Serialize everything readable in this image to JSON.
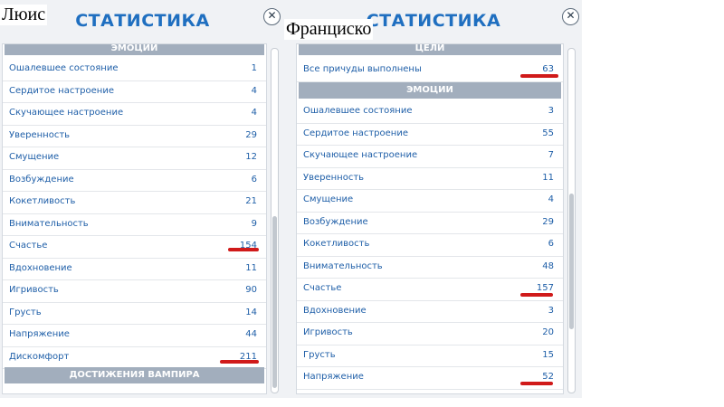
{
  "left": {
    "name_label": "Люис",
    "title": "СТАТИСТИКА",
    "close": "✕",
    "section_top": "ЭМОЦИИ",
    "rows": [
      {
        "label": "Ошалевшее состояние",
        "value": "1"
      },
      {
        "label": "Сердитое настроение",
        "value": "4"
      },
      {
        "label": "Скучающее настроение",
        "value": "4"
      },
      {
        "label": "Уверенность",
        "value": "29"
      },
      {
        "label": "Смущение",
        "value": "12"
      },
      {
        "label": "Возбуждение",
        "value": "6"
      },
      {
        "label": "Кокетливость",
        "value": "21"
      },
      {
        "label": "Внимательность",
        "value": "9"
      },
      {
        "label": "Счастье",
        "value": "154"
      },
      {
        "label": "Вдохновение",
        "value": "11"
      },
      {
        "label": "Игривость",
        "value": "90"
      },
      {
        "label": "Грусть",
        "value": "14"
      },
      {
        "label": "Напряжение",
        "value": "44"
      },
      {
        "label": "Дискомфорт",
        "value": "211"
      }
    ],
    "section_bottom": "ДОСТИЖЕНИЯ ВАМПИРА"
  },
  "right": {
    "name_label": "Франциско",
    "title": "СТАТИСТИКА",
    "close": "✕",
    "section_goals": "ЦЕЛИ",
    "goal_row": {
      "label": "Все причуды выполнены",
      "value": "63"
    },
    "section_emotions": "ЭМОЦИИ",
    "rows": [
      {
        "label": "Ошалевшее состояние",
        "value": "3"
      },
      {
        "label": "Сердитое настроение",
        "value": "55"
      },
      {
        "label": "Скучающее настроение",
        "value": "7"
      },
      {
        "label": "Уверенность",
        "value": "11"
      },
      {
        "label": "Смущение",
        "value": "4"
      },
      {
        "label": "Возбуждение",
        "value": "29"
      },
      {
        "label": "Кокетливость",
        "value": "6"
      },
      {
        "label": "Внимательность",
        "value": "48"
      },
      {
        "label": "Счастье",
        "value": "157"
      },
      {
        "label": "Вдохновение",
        "value": "3"
      },
      {
        "label": "Игривость",
        "value": "20"
      },
      {
        "label": "Грусть",
        "value": "15"
      },
      {
        "label": "Напряжение",
        "value": "52"
      }
    ]
  },
  "colors": {
    "accent": "#1f6fc0",
    "section_header": "#a2aebd",
    "annotation": "#d01a1a"
  }
}
